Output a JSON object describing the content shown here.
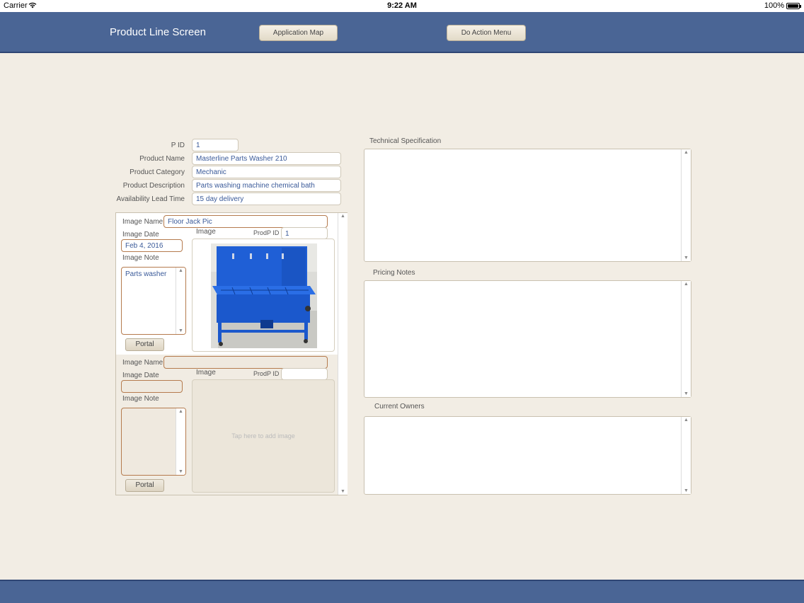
{
  "status_bar": {
    "carrier": "Carrier",
    "time": "9:22 AM",
    "battery": "100%"
  },
  "header": {
    "title": "Product Line Screen",
    "application_map_label": "Application Map",
    "action_menu_label": "Do Action Menu"
  },
  "form": {
    "pid_label": "P ID",
    "pid_value": "1",
    "name_label": "Product Name",
    "name_value": "Masterline Parts Washer 210",
    "category_label": "Product Category",
    "category_value": "Mechanic",
    "description_label": "Product Description",
    "description_value": "Parts washing machine chemical bath",
    "lead_time_label": "Availability Lead Time",
    "lead_time_value": "15 day delivery"
  },
  "portal": {
    "rows": [
      {
        "image_name_label": "Image Name",
        "image_name_value": "Floor Jack Pic",
        "image_date_label": "Image Date",
        "image_date_value": "Feb 4, 2016",
        "image_note_label": "Image Note",
        "image_note_value": "Parts washer",
        "image_label": "Image",
        "prodp_id_label": "ProdP ID",
        "prodp_id_value": "1",
        "portal_button": "Portal"
      },
      {
        "image_name_label": "Image Name",
        "image_name_value": "",
        "image_date_label": "Image Date",
        "image_date_value": "",
        "image_note_label": "Image Note",
        "image_note_value": "",
        "image_label": "Image",
        "prodp_id_label": "ProdP ID",
        "prodp_id_value": "",
        "image_placeholder": "Tap here to add image",
        "portal_button": "Portal"
      }
    ]
  },
  "panels": {
    "tech_spec_label": "Technical Specification",
    "pricing_notes_label": "Pricing Notes",
    "current_owners_label": "Current Owners"
  },
  "colors": {
    "header_bg": "#4a6595",
    "page_bg": "#f2ede4",
    "field_text": "#3a5a99",
    "portal_field_border": "#b57b4e"
  }
}
